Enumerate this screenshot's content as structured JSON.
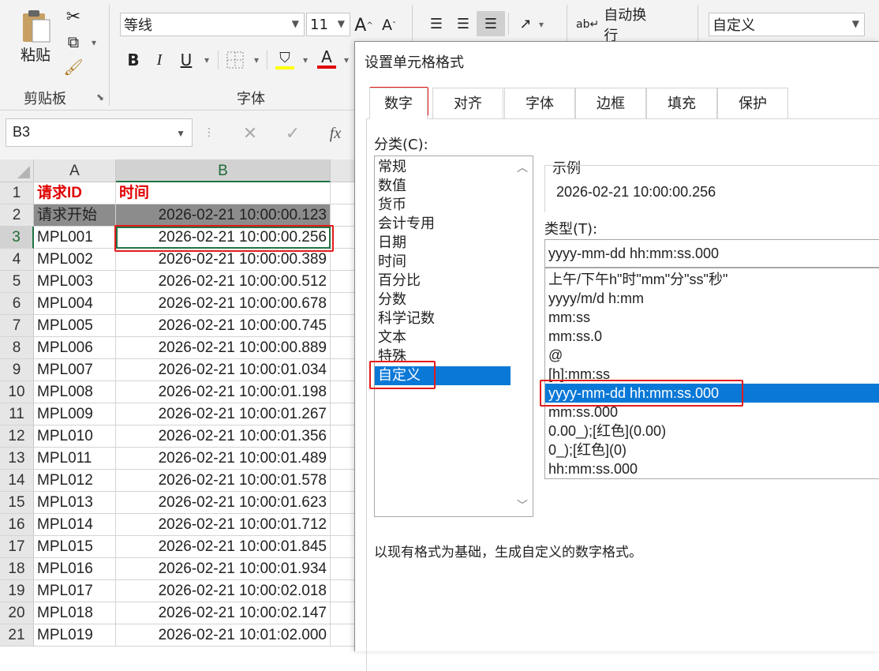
{
  "ribbon": {
    "clipboard": {
      "paste_label": "粘贴",
      "group_label": "剪贴板"
    },
    "font": {
      "font_name": "等线",
      "font_size": "11",
      "group_label": "字体",
      "bold": "B",
      "italic": "I",
      "underline": "U",
      "font_color_glyph": "A"
    },
    "alignment": {
      "wrap_text_label": "自动换行"
    },
    "number": {
      "format_value": "自定义"
    }
  },
  "formula_bar": {
    "name_box": "B3",
    "fx": "fx"
  },
  "sheet": {
    "columns": [
      "A",
      "B"
    ],
    "rows": [
      {
        "num": "1",
        "a": "请求ID",
        "b": "时间"
      },
      {
        "num": "2",
        "a": "请求开始",
        "b": "2026-02-21 10:00:00.123"
      },
      {
        "num": "3",
        "a": "MPL001",
        "b": "2026-02-21 10:00:00.256"
      },
      {
        "num": "4",
        "a": "MPL002",
        "b": "2026-02-21 10:00:00.389"
      },
      {
        "num": "5",
        "a": "MPL003",
        "b": "2026-02-21 10:00:00.512"
      },
      {
        "num": "6",
        "a": "MPL004",
        "b": "2026-02-21 10:00:00.678"
      },
      {
        "num": "7",
        "a": "MPL005",
        "b": "2026-02-21 10:00:00.745"
      },
      {
        "num": "8",
        "a": "MPL006",
        "b": "2026-02-21 10:00:00.889"
      },
      {
        "num": "9",
        "a": "MPL007",
        "b": "2026-02-21 10:00:01.034"
      },
      {
        "num": "10",
        "a": "MPL008",
        "b": "2026-02-21 10:00:01.198"
      },
      {
        "num": "11",
        "a": "MPL009",
        "b": "2026-02-21 10:00:01.267"
      },
      {
        "num": "12",
        "a": "MPL010",
        "b": "2026-02-21 10:00:01.356"
      },
      {
        "num": "13",
        "a": "MPL011",
        "b": "2026-02-21 10:00:01.489"
      },
      {
        "num": "14",
        "a": "MPL012",
        "b": "2026-02-21 10:00:01.578"
      },
      {
        "num": "15",
        "a": "MPL013",
        "b": "2026-02-21 10:00:01.623"
      },
      {
        "num": "16",
        "a": "MPL014",
        "b": "2026-02-21 10:00:01.712"
      },
      {
        "num": "17",
        "a": "MPL015",
        "b": "2026-02-21 10:00:01.845"
      },
      {
        "num": "18",
        "a": "MPL016",
        "b": "2026-02-21 10:00:01.934"
      },
      {
        "num": "19",
        "a": "MPL017",
        "b": "2026-02-21 10:00:02.018"
      },
      {
        "num": "20",
        "a": "MPL018",
        "b": "2026-02-21 10:00:02.147"
      },
      {
        "num": "21",
        "a": "MPL019",
        "b": "2026-02-21 10:01:02.000"
      }
    ]
  },
  "dialog": {
    "title": "设置单元格格式",
    "tabs": [
      "数字",
      "对齐",
      "字体",
      "边框",
      "填充",
      "保护"
    ],
    "category_label": "分类(C):",
    "categories": [
      "常规",
      "数值",
      "货币",
      "会计专用",
      "日期",
      "时间",
      "百分比",
      "分数",
      "科学记数",
      "文本",
      "特殊",
      "自定义"
    ],
    "sample_label": "示例",
    "sample_value": "2026-02-21 10:00:00.256",
    "type_label": "类型(T):",
    "type_value": "yyyy-mm-dd hh:mm:ss.000",
    "type_list": [
      "上午/下午h\"时\"mm\"分\"ss\"秒\"",
      "yyyy/m/d h:mm",
      "mm:ss",
      "mm:ss.0",
      "@",
      "[h]:mm:ss",
      "yyyy-mm-dd hh:mm:ss.000",
      "mm:ss.000",
      "0.00_);[红色](0.00)",
      "0_);[红色](0)",
      "hh:mm:ss.000"
    ],
    "description": "以现有格式为基础，生成自定义的数字格式。"
  },
  "colors": {
    "accent_green": "#217346",
    "highlight_red": "#e21b1b",
    "selection_blue": "#0a78d7"
  }
}
